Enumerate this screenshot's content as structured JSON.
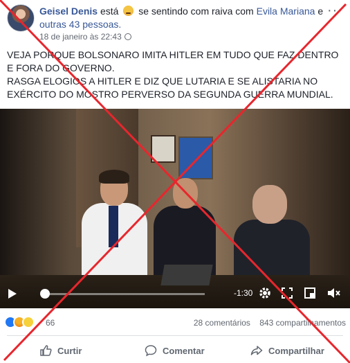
{
  "post": {
    "author": "Geisel Denis",
    "feeling_prefix": "está",
    "feeling_text": "se sentindo com raiva com",
    "tagged": "Evila Mariana",
    "and": "e",
    "others": "outras 43 pessoas.",
    "timestamp": "18 de janeiro às 22:43",
    "more_label": "···",
    "text_lines": [
      "VEJA PORQUE BOLSONARO IMITA HITLER EM TUDO QUE FAZ DENTRO",
      "E FORA DO GOVERNO.",
      "RASGA ELOGIOS A HITLER E DIZ QUE LUTARIA E SE ALISTARIA NO",
      "EXÉRCITO DO MOSTRO PERVERSO DA SEGUNDA GUERRA MUNDIAL."
    ]
  },
  "video": {
    "time_remaining": "-1:30",
    "progress": 0.02
  },
  "engagement": {
    "reaction_count": "66",
    "comments": "28 comentários",
    "shares": "843 compartilhamentos"
  },
  "actions": {
    "like": "Curtir",
    "comment": "Comentar",
    "share": "Compartilhar"
  },
  "colors": {
    "link": "#385898",
    "cross": "#e8262d",
    "like_blue": "#2078f4"
  }
}
